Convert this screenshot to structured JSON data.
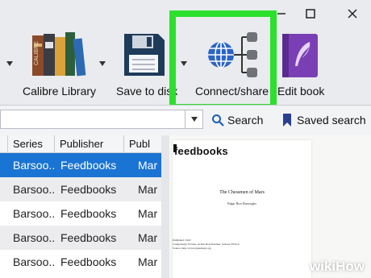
{
  "toolbar": {
    "calibre_library_label": "Calibre Library",
    "save_to_disk_label": "Save to disk",
    "connect_share_label": "Connect/share",
    "edit_book_label": "Edit book"
  },
  "search": {
    "search_button_label": "Search",
    "saved_search_label": "Saved search",
    "query": ""
  },
  "table": {
    "headers": [
      "Series",
      "Publisher",
      "Publ"
    ],
    "rows": [
      {
        "series": "Barsoo...",
        "publisher": "Feedbooks",
        "published": "Mar"
      },
      {
        "series": "Barsoo...",
        "publisher": "Feedbooks",
        "published": "Mar"
      },
      {
        "series": "Barsoo...",
        "publisher": "Feedbooks",
        "published": "Mar"
      },
      {
        "series": "Barsoo...",
        "publisher": "Feedbooks",
        "published": "Mar"
      },
      {
        "series": "Barsoo...",
        "publisher": "Feedbooks",
        "published": "Mar"
      }
    ]
  },
  "preview": {
    "brand": "feedbooks",
    "book_title": "The Chessmen of Mars",
    "author": "Edgar Rice Burroughs",
    "meta_published": "Published: 1922",
    "meta_categories": "Categorie(s): Fiction, Action & Adventure, Science Fiction",
    "meta_source": "Source: http://www.gutenberg.org"
  },
  "watermark": {
    "text": "wikiHow"
  },
  "colors": {
    "highlight": "#2de02d",
    "selection": "#1a74d3"
  }
}
